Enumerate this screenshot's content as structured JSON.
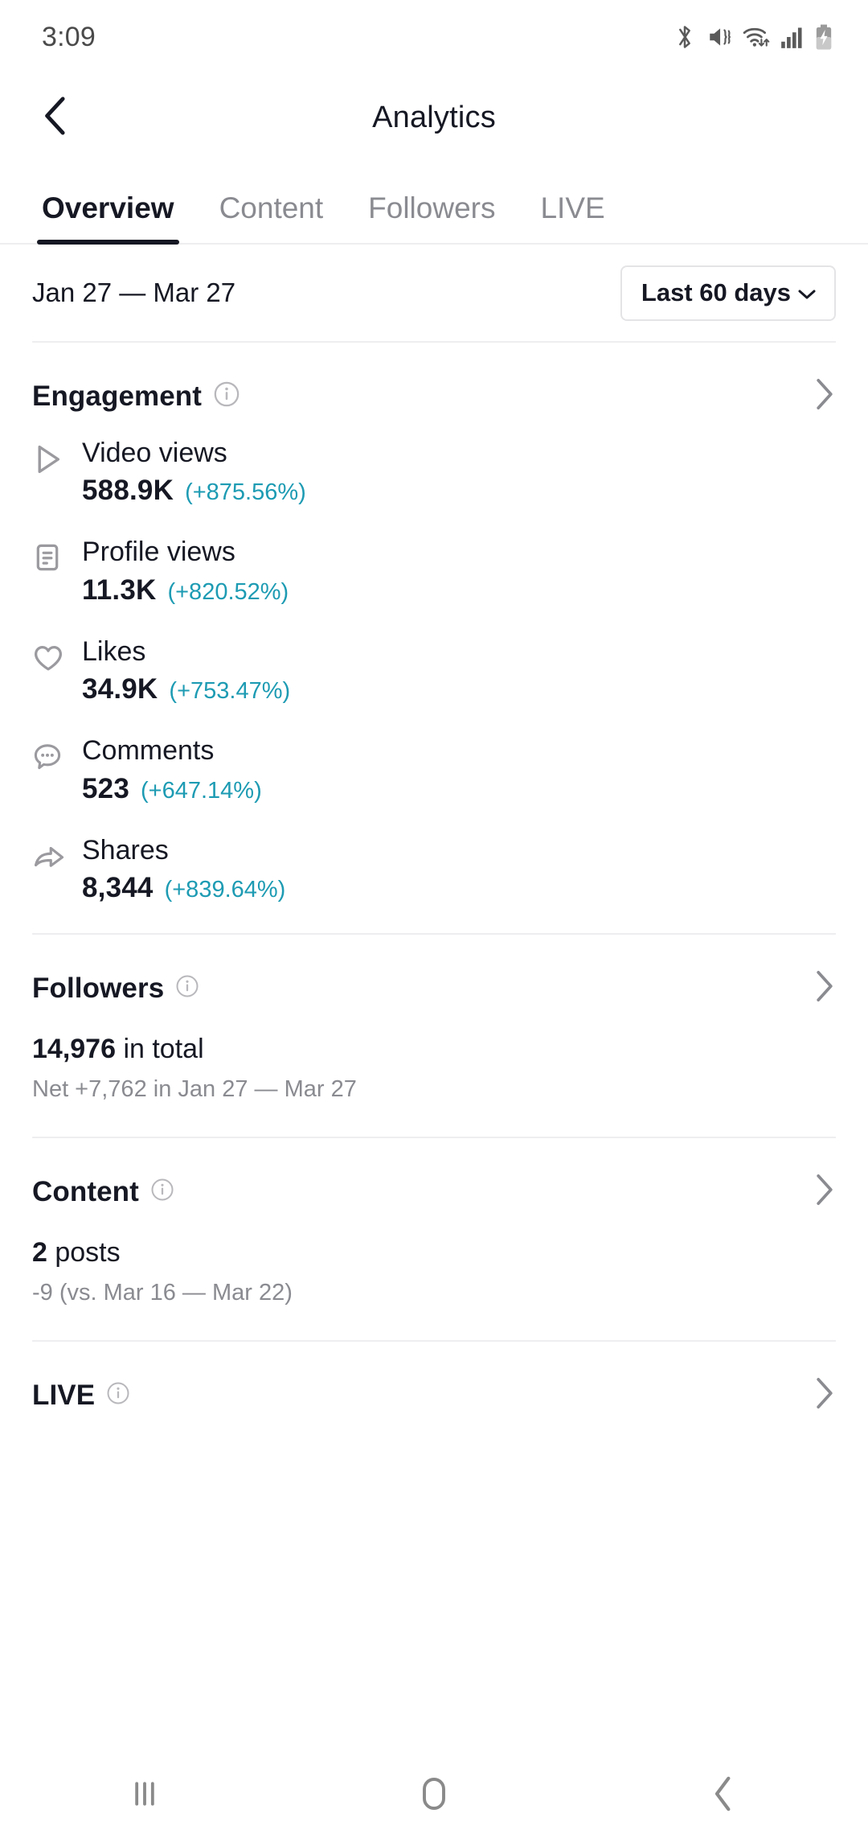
{
  "status_bar": {
    "time": "3:09",
    "icons": [
      "bluetooth-icon",
      "mute-vibrate-icon",
      "wifi-icon",
      "cellular-signal-icon",
      "battery-charging-icon"
    ]
  },
  "header": {
    "back_icon": "chevron-left-icon",
    "title": "Analytics"
  },
  "tabs": [
    {
      "label": "Overview",
      "active": true
    },
    {
      "label": "Content",
      "active": false
    },
    {
      "label": "Followers",
      "active": false
    },
    {
      "label": "LIVE",
      "active": false
    }
  ],
  "date_bar": {
    "range_text": "Jan 27 — Mar 27",
    "picker_label": "Last 60 days",
    "picker_icon": "chevron-down-icon"
  },
  "colors": {
    "accent_teal": "#1d9bb3",
    "text_primary": "#161823",
    "text_muted": "#8a8b91",
    "divider": "#eeeef0"
  },
  "engagement": {
    "title": "Engagement",
    "info_icon": "info-icon",
    "chevron_icon": "chevron-right-icon",
    "metrics": [
      {
        "icon": "play-icon",
        "label": "Video views",
        "value": "588.9K",
        "delta": "(+875.56%)"
      },
      {
        "icon": "document-icon",
        "label": "Profile views",
        "value": "11.3K",
        "delta": "(+820.52%)"
      },
      {
        "icon": "heart-icon",
        "label": "Likes",
        "value": "34.9K",
        "delta": "(+753.47%)"
      },
      {
        "icon": "comment-icon",
        "label": "Comments",
        "value": "523",
        "delta": "(+647.14%)"
      },
      {
        "icon": "share-icon",
        "label": "Shares",
        "value": "8,344",
        "delta": "(+839.64%)"
      }
    ]
  },
  "followers": {
    "title": "Followers",
    "info_icon": "info-icon",
    "chevron_icon": "chevron-right-icon",
    "total_value": "14,976",
    "total_suffix": " in total",
    "sub_text": "Net +7,762 in Jan 27 — Mar 27"
  },
  "content": {
    "title": "Content",
    "info_icon": "info-icon",
    "chevron_icon": "chevron-right-icon",
    "total_value": "2",
    "total_suffix": " posts",
    "sub_text": "-9 (vs. Mar 16 — Mar 22)"
  },
  "live": {
    "title": "LIVE",
    "info_icon": "info-icon",
    "chevron_icon": "chevron-right-icon"
  },
  "nav_bar": {
    "recents_icon": "recents-icon",
    "home_icon": "home-icon",
    "back_icon": "back-icon"
  }
}
